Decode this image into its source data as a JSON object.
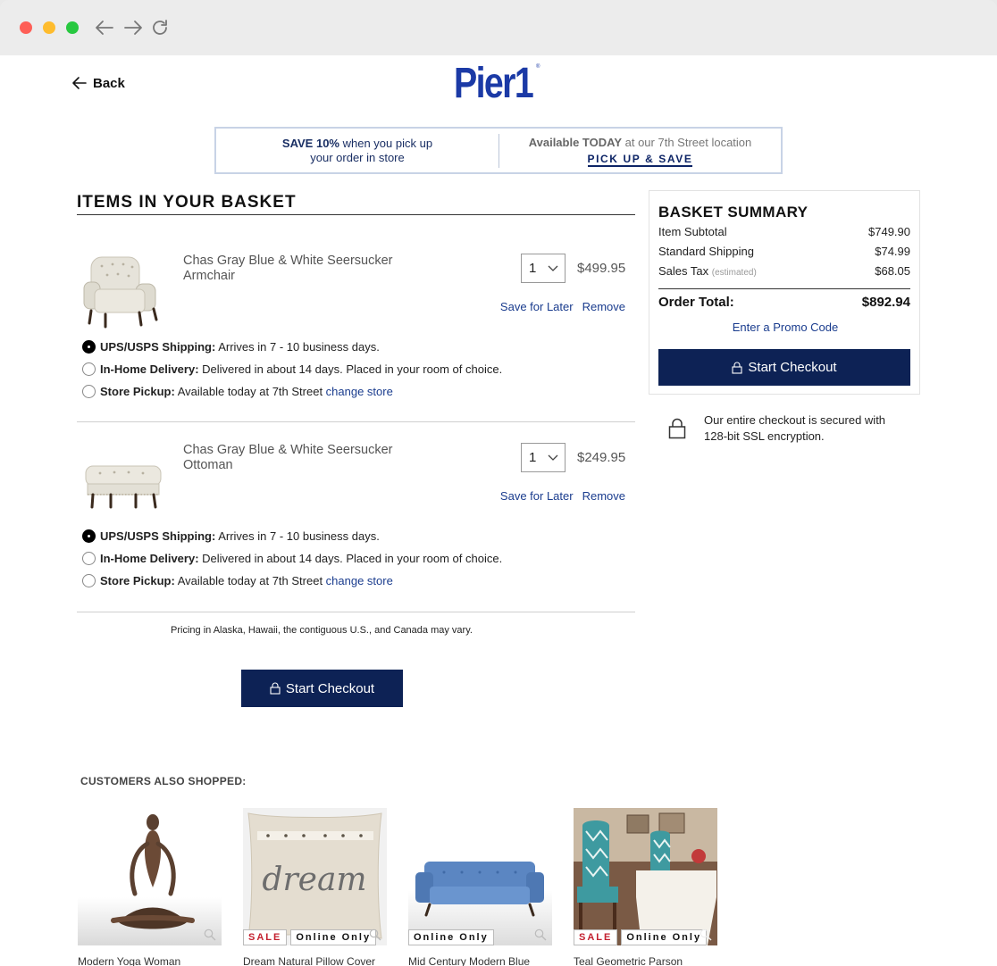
{
  "header": {
    "back_label": "Back",
    "logo_text": "Pier1"
  },
  "promo": {
    "left_bold": "SAVE 10%",
    "left_rest": " when you pick up",
    "left_line2": "your order in store",
    "right_bold": "Available TODAY",
    "right_rest": " at our 7th Street location",
    "link": "PICK UP & SAVE"
  },
  "basket": {
    "title": "ITEMS IN YOUR BASKET",
    "items": [
      {
        "name": "Chas Gray Blue & White Seersucker Armchair",
        "qty": "1",
        "price": "$499.95",
        "save_label": "Save for Later",
        "remove_label": "Remove",
        "options": [
          {
            "bold": "UPS/USPS Shipping:",
            "text": " Arrives in 7 - 10 business days.",
            "link": "",
            "selected": true
          },
          {
            "bold": "In-Home Delivery:",
            "text": " Delivered in about 14 days. Placed in your room of choice.",
            "link": "",
            "selected": false
          },
          {
            "bold": "Store Pickup:",
            "text": " Available today at 7th Street ",
            "link": "change store",
            "selected": false
          }
        ]
      },
      {
        "name": "Chas Gray Blue & White Seersucker Ottoman",
        "qty": "1",
        "price": "$249.95",
        "save_label": "Save for Later",
        "remove_label": "Remove",
        "options": [
          {
            "bold": "UPS/USPS Shipping:",
            "text": " Arrives in 7 - 10 business days.",
            "link": "",
            "selected": true
          },
          {
            "bold": "In-Home Delivery:",
            "text": " Delivered in about 14 days. Placed in your room of choice.",
            "link": "",
            "selected": false
          },
          {
            "bold": "Store Pickup:",
            "text": " Available today at 7th Street ",
            "link": "change store",
            "selected": false
          }
        ]
      }
    ],
    "pricing_note": "Pricing in Alaska, Hawaii, the contiguous U.S., and Canada may vary.",
    "checkout_label": "Start Checkout"
  },
  "summary": {
    "title": "BASKET SUMMARY",
    "rows": [
      {
        "label": "Item Subtotal",
        "note": "",
        "value": "$749.90"
      },
      {
        "label": "Standard Shipping",
        "note": "",
        "value": "$74.99"
      },
      {
        "label": "Sales Tax",
        "note": "(estimated)",
        "value": "$68.05"
      }
    ],
    "total_label": "Order Total:",
    "total_value": "$892.94",
    "promo_code_label": "Enter a Promo Code",
    "checkout_label": "Start Checkout",
    "secure_text": "Our entire checkout is secured with 128-bit SSL encryption."
  },
  "also_shopped": {
    "title": "CUSTOMERS ALSO SHOPPED:",
    "products": [
      {
        "name": "Modern Yoga Woman",
        "tags": []
      },
      {
        "name": "Dream Natural Pillow Cover",
        "tags": [
          "SALE",
          "Online Only"
        ]
      },
      {
        "name": "Mid Century Modern Blue",
        "tags": [
          "Online Only"
        ]
      },
      {
        "name": "Teal Geometric Parson",
        "tags": [
          "SALE",
          "Online Only"
        ]
      }
    ]
  },
  "colors": {
    "navy": "#0d2255",
    "link_blue": "#1a3c8e",
    "logo_blue": "#1b3aa6",
    "sale_red": "#c3202f"
  }
}
